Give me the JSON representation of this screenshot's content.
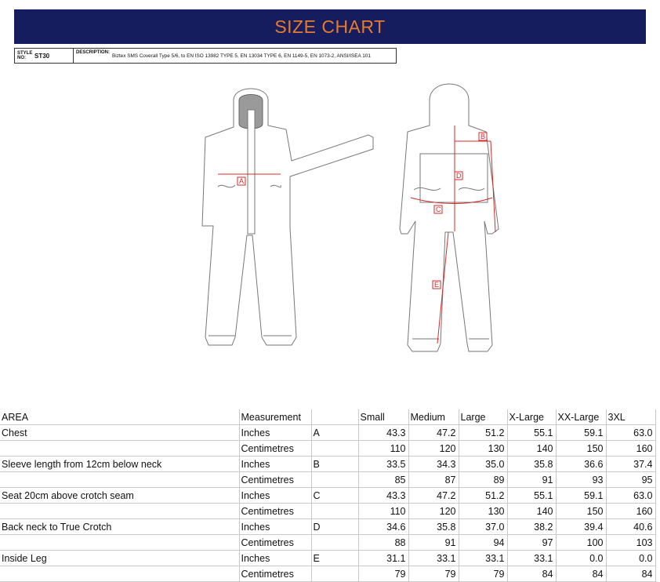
{
  "header": {
    "title": "SIZE CHART"
  },
  "info": {
    "style_label": "STYLE NO:",
    "style_value": "ST30",
    "description_label": "DESCRIPTION:",
    "description_value": "Biztex SMS Coverall Type 5/6, to EN ISO 13982 TYPE 5, EN 13034 TYPE 6, EN 1149-5, EN 1073-2, ANSI/ISEA 101"
  },
  "diagram": {
    "markers": [
      "A",
      "B",
      "C",
      "D",
      "E"
    ],
    "colors": {
      "measure": "#d42a2a",
      "outline": "#777777",
      "banner": "#161d5e",
      "title": "#e97a2b"
    }
  },
  "table": {
    "headers": [
      "AREA",
      "Measurement",
      "",
      "Small",
      "Medium",
      "Large",
      "X-Large",
      "XX-Large",
      "3XL"
    ],
    "rows": [
      [
        "Chest",
        "Inches",
        "A",
        "43.3",
        "47.2",
        "51.2",
        "55.1",
        "59.1",
        "63.0"
      ],
      [
        "",
        "Centimetres",
        "",
        "110",
        "120",
        "130",
        "140",
        "150",
        "160"
      ],
      [
        "Sleeve length from 12cm below neck",
        "Inches",
        "B",
        "33.5",
        "34.3",
        "35.0",
        "35.8",
        "36.6",
        "37.4"
      ],
      [
        "",
        "Centimetres",
        "",
        "85",
        "87",
        "89",
        "91",
        "93",
        "95"
      ],
      [
        "Seat 20cm above crotch seam",
        "Inches",
        "C",
        "43.3",
        "47.2",
        "51.2",
        "55.1",
        "59.1",
        "63.0"
      ],
      [
        "",
        "Centimetres",
        "",
        "110",
        "120",
        "130",
        "140",
        "150",
        "160"
      ],
      [
        "Back neck to True Crotch",
        "Inches",
        "D",
        "34.6",
        "35.8",
        "37.0",
        "38.2",
        "39.4",
        "40.6"
      ],
      [
        "",
        "Centimetres",
        "",
        "88",
        "91",
        "94",
        "97",
        "100",
        "103"
      ],
      [
        "Inside Leg",
        "Inches",
        "E",
        "31.1",
        "33.1",
        "33.1",
        "33.1",
        "0.0",
        "0.0"
      ],
      [
        "",
        "Centimetres",
        "",
        "79",
        "79",
        "79",
        "84",
        "84",
        "84"
      ]
    ]
  }
}
